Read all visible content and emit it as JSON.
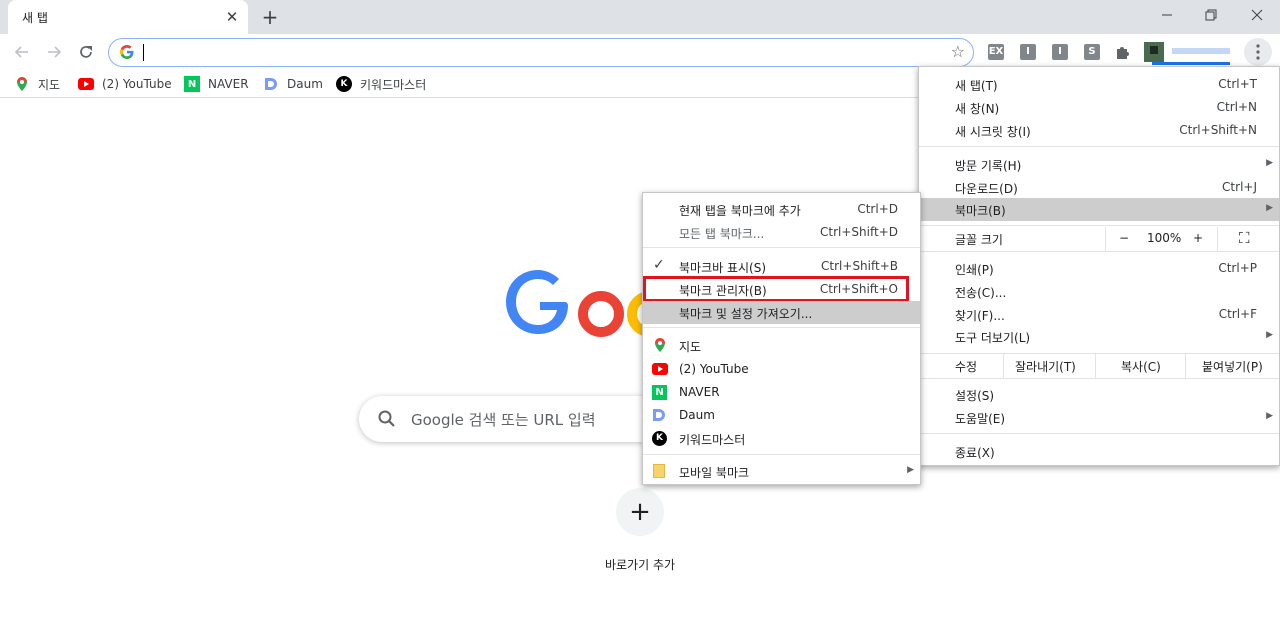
{
  "tab": {
    "title": "새 탭",
    "close": "✕",
    "new_tab": "+"
  },
  "window": {
    "minimize": "–",
    "restore": "⧉",
    "close": "✕"
  },
  "toolbar": {
    "back": "←",
    "forward": "→",
    "reload": "⟳",
    "omnibox_value": "",
    "star": "☆"
  },
  "extensions": [
    {
      "name": "ex-icon",
      "text": "EX"
    },
    {
      "name": "i1-icon",
      "text": "I"
    },
    {
      "name": "i2-icon",
      "text": "I"
    },
    {
      "name": "s-icon",
      "text": "S"
    }
  ],
  "bookmarks_bar": [
    {
      "label": "지도",
      "icon": "maps-icon"
    },
    {
      "label": "(2) YouTube",
      "icon": "youtube-icon"
    },
    {
      "label": "NAVER",
      "icon": "naver-icon"
    },
    {
      "label": "Daum",
      "icon": "daum-icon"
    },
    {
      "label": "키워드마스터",
      "icon": "k-icon"
    }
  ],
  "ntp": {
    "search_placeholder": "Google 검색 또는 URL 입력",
    "shortcut_plus": "+",
    "shortcut_label": "바로가기 추가"
  },
  "main_menu": {
    "items": [
      {
        "label": "새 탭(T)",
        "shortcut": "Ctrl+T"
      },
      {
        "label": "새 창(N)",
        "shortcut": "Ctrl+N"
      },
      {
        "label": "새 시크릿 창(I)",
        "shortcut": "Ctrl+Shift+N"
      },
      {
        "label": "방문 기록(H)",
        "arrow": "▶"
      },
      {
        "label": "다운로드(D)",
        "shortcut": "Ctrl+J"
      },
      {
        "label": "북마크(B)",
        "arrow": "▶"
      },
      {
        "label": "인쇄(P)",
        "shortcut": "Ctrl+P"
      },
      {
        "label": "전송(C)..."
      },
      {
        "label": "찾기(F)...",
        "shortcut": "Ctrl+F"
      },
      {
        "label": "도구 더보기(L)",
        "arrow": "▶"
      },
      {
        "label": "설정(S)"
      },
      {
        "label": "도움말(E)",
        "arrow": "▶"
      },
      {
        "label": "종료(X)"
      }
    ],
    "zoom": {
      "label": "글꼴 크기",
      "minus": "−",
      "value": "100%",
      "plus": "+",
      "fullscreen": "⛶"
    },
    "edit": {
      "label": "수정",
      "cut": "잘라내기(T)",
      "copy": "복사(C)",
      "paste": "붙여넣기(P)"
    }
  },
  "bookmark_menu": {
    "items": [
      {
        "label": "현재 탭을 북마크에 추가",
        "shortcut": "Ctrl+D"
      },
      {
        "label": "모든 탭 북마크...",
        "shortcut": "Ctrl+Shift+D"
      },
      {
        "label": "북마크바 표시(S)",
        "shortcut": "Ctrl+Shift+B",
        "check": "✓"
      },
      {
        "label": "북마크 관리자(B)",
        "shortcut": "Ctrl+Shift+O"
      },
      {
        "label": "북마크 및 설정 가져오기..."
      },
      {
        "label": "지도"
      },
      {
        "label": "(2) YouTube"
      },
      {
        "label": "NAVER"
      },
      {
        "label": "Daum"
      },
      {
        "label": "키워드마스터"
      },
      {
        "label": "모바일 북마크",
        "arrow": "▶"
      }
    ]
  },
  "colors": {
    "highlight_box": "#e0141e",
    "accent": "#1a73e8"
  }
}
